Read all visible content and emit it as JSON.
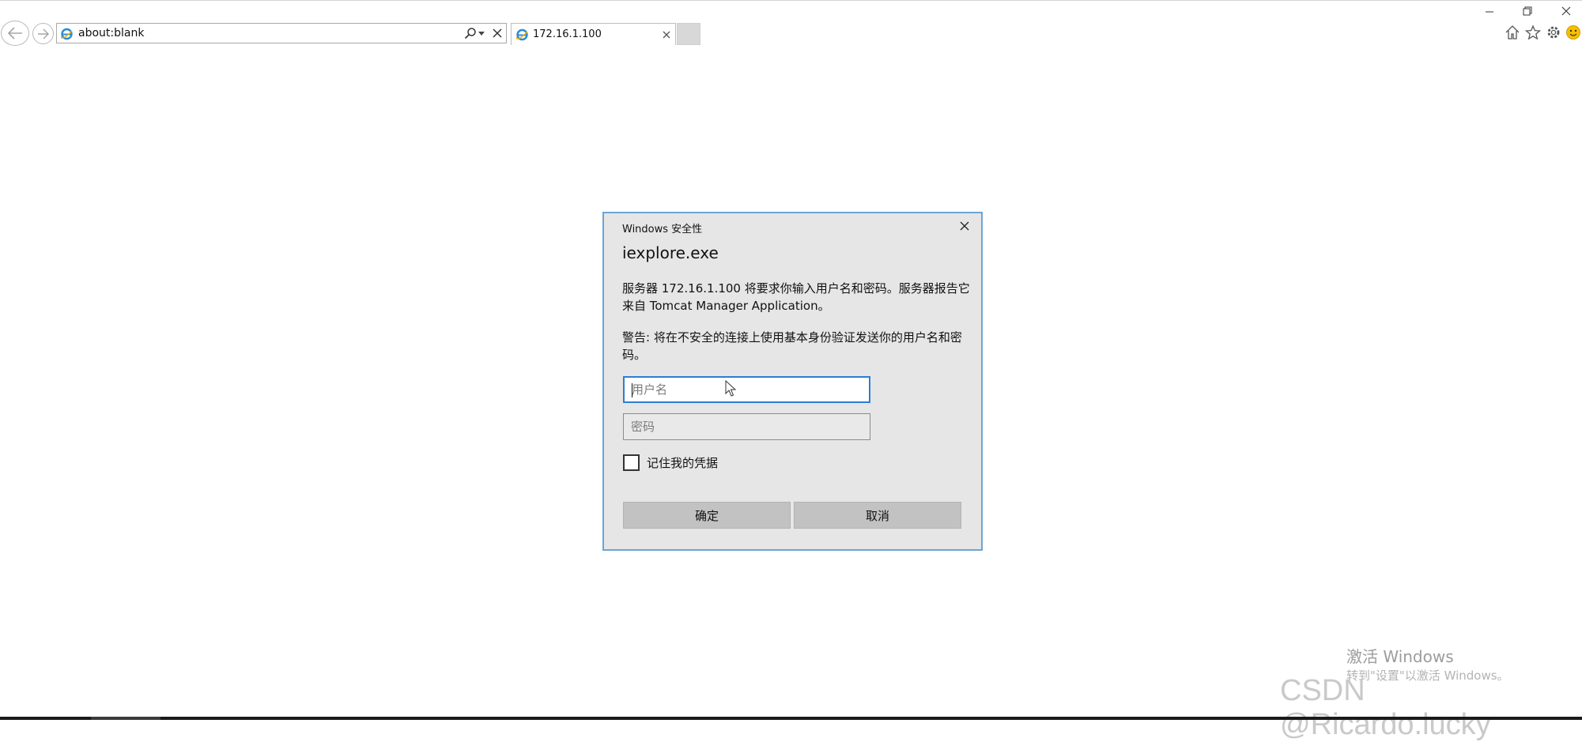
{
  "browser": {
    "address": "about:blank",
    "tab_title": "172.16.1.100"
  },
  "dialog": {
    "header": "Windows 安全性",
    "title": "iexplore.exe",
    "message": "服务器 172.16.1.100 将要求你输入用户名和密码。服务器报告它来自 Tomcat Manager Application。",
    "warning": "警告: 将在不安全的连接上使用基本身份验证发送你的用户名和密码。",
    "username_placeholder": "用户名",
    "username_value": "",
    "password_placeholder": "密码",
    "password_value": "",
    "remember_label": "记住我的凭据",
    "remember_checked": false,
    "ok_label": "确定",
    "cancel_label": "取消"
  },
  "watermark": {
    "activate_title": "激活 Windows",
    "activate_sub": "转到\"设置\"以激活 Windows。",
    "csdn": "CSDN @Ricardo.lucky"
  },
  "colors": {
    "dialog_border": "#6aa5d9",
    "focus_border": "#2d7dd2",
    "dialog_bg": "#e6e6e6",
    "button_bg": "#c2c2c2"
  }
}
